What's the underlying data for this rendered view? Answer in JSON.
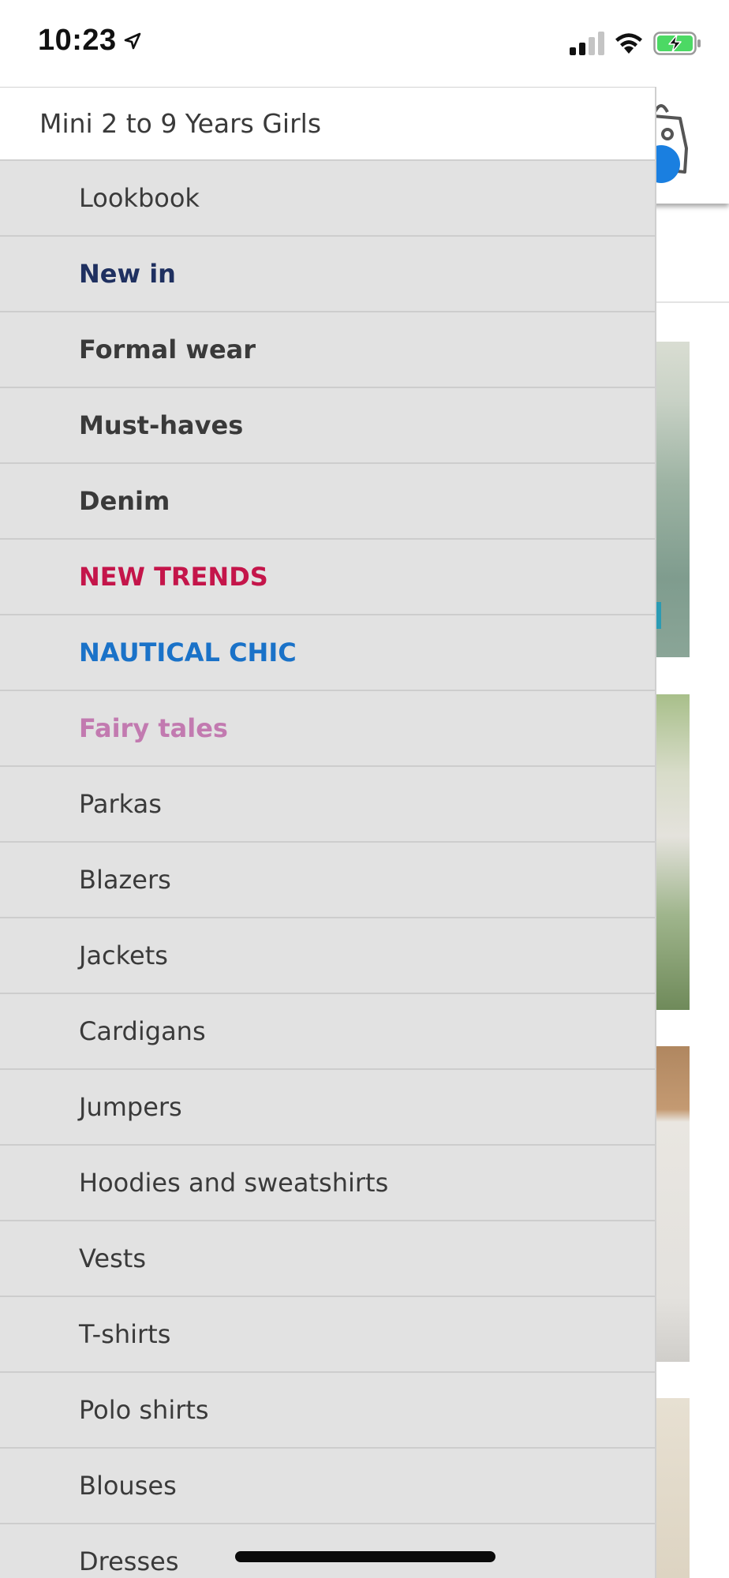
{
  "status_bar": {
    "time": "10:23"
  },
  "drawer": {
    "title": "Mini 2 to 9 Years Girls",
    "items": [
      {
        "label": "Lookbook",
        "color": "#3a3a3a",
        "bold": false
      },
      {
        "label": "New in",
        "color": "#1f3060",
        "bold": true
      },
      {
        "label": "Formal wear",
        "color": "#3a3a3a",
        "bold": true
      },
      {
        "label": "Must-haves",
        "color": "#3a3a3a",
        "bold": true
      },
      {
        "label": "Denim",
        "color": "#3a3a3a",
        "bold": true
      },
      {
        "label": "NEW TRENDS",
        "color": "#c4154a",
        "bold": true
      },
      {
        "label": "NAUTICAL CHIC",
        "color": "#1a72c8",
        "bold": true
      },
      {
        "label": "Fairy tales",
        "color": "#c27ab0",
        "bold": true
      },
      {
        "label": "Parkas",
        "color": "#3a3a3a",
        "bold": false
      },
      {
        "label": "Blazers",
        "color": "#3a3a3a",
        "bold": false
      },
      {
        "label": "Jackets",
        "color": "#3a3a3a",
        "bold": false
      },
      {
        "label": "Cardigans",
        "color": "#3a3a3a",
        "bold": false
      },
      {
        "label": "Jumpers",
        "color": "#3a3a3a",
        "bold": false
      },
      {
        "label": "Hoodies and sweatshirts",
        "color": "#3a3a3a",
        "bold": false
      },
      {
        "label": "Vests",
        "color": "#3a3a3a",
        "bold": false
      },
      {
        "label": "T-shirts",
        "color": "#3a3a3a",
        "bold": false
      },
      {
        "label": "Polo shirts",
        "color": "#3a3a3a",
        "bold": false
      },
      {
        "label": "Blouses",
        "color": "#3a3a3a",
        "bold": false
      },
      {
        "label": "Dresses",
        "color": "#3a3a3a",
        "bold": false
      }
    ]
  },
  "background": {
    "cart_icon": "shopping-bag-icon",
    "cart_badge_color": "#1a7fe0"
  },
  "colors": {
    "drawer_background": "#e2e2e2",
    "battery_charging": "#4cd964"
  }
}
